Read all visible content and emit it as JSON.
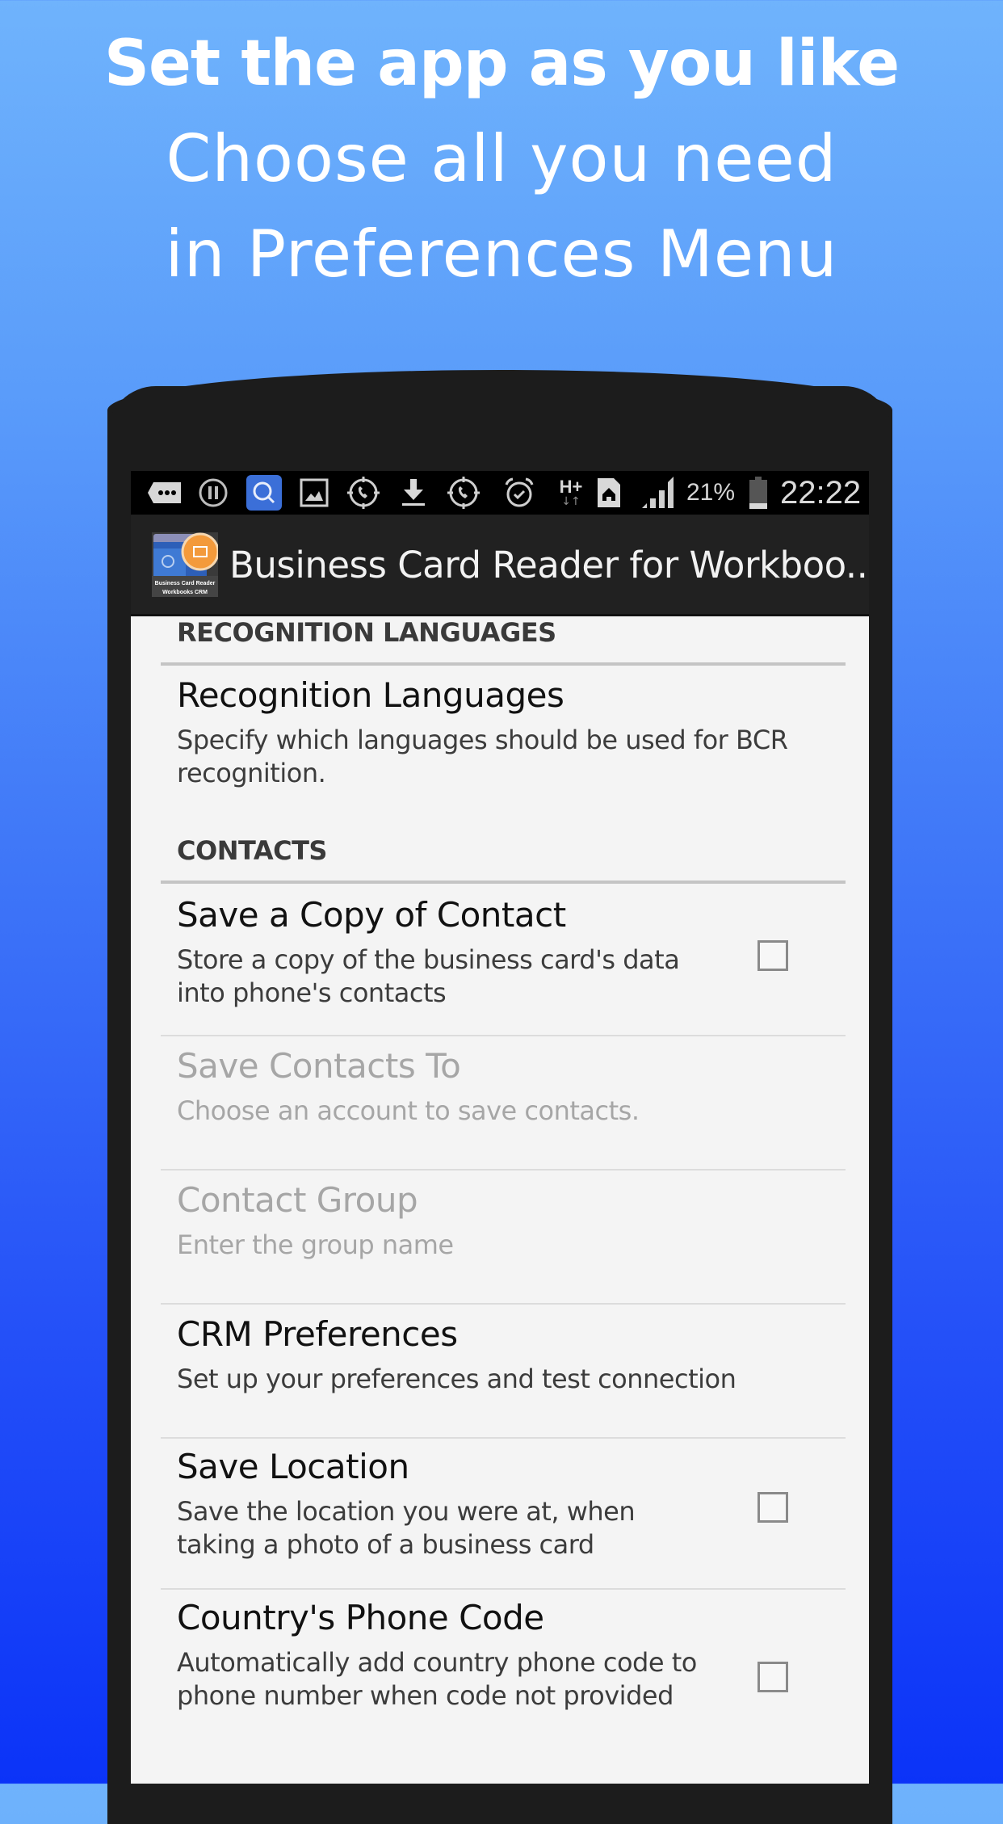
{
  "promo": {
    "headline": "Set the app as you like",
    "subline1": "Choose all you need",
    "subline2": "in Preferences Menu"
  },
  "status_bar": {
    "icons": [
      "messages-icon",
      "pause-icon",
      "search-app-icon",
      "gallery-icon",
      "call-recorder-icon",
      "download-icon",
      "call-recorder-icon",
      "alarm-icon",
      "h-plus-data-icon",
      "home-sim-icon",
      "signal-icon",
      "battery-icon"
    ],
    "network": "H+",
    "battery_percent": "21%",
    "time": "22:22"
  },
  "action_bar": {
    "app_title": "Business Card Reader for Workboo...",
    "icon_caption_1": "Business Card Reader",
    "icon_caption_2": "Workbooks CRM"
  },
  "preferences": {
    "categories": [
      {
        "header": "RECOGNITION LANGUAGES",
        "items": [
          {
            "title": "Recognition Languages",
            "summary": "Specify which languages should be used for BCR recognition.",
            "enabled": true,
            "has_checkbox": false
          }
        ]
      },
      {
        "header": "CONTACTS",
        "items": [
          {
            "title": "Save a Copy of Contact",
            "summary": "Store a copy of the business card's data into phone's contacts",
            "enabled": true,
            "has_checkbox": true,
            "checked": false
          },
          {
            "title": "Save Contacts To",
            "summary": "Choose an account to save contacts.",
            "enabled": false,
            "has_checkbox": false
          },
          {
            "title": "Contact Group",
            "summary": "Enter the group name",
            "enabled": false,
            "has_checkbox": false
          },
          {
            "title": "CRM Preferences",
            "summary": "Set up your preferences and test connection",
            "enabled": true,
            "has_checkbox": false
          },
          {
            "title": "Save Location",
            "summary": "Save the location you were at, when taking a photo of a business card",
            "enabled": true,
            "has_checkbox": true,
            "checked": false
          },
          {
            "title": "Country's Phone Code",
            "summary": "Automatically add country phone code to phone number when code not provided",
            "enabled": true,
            "has_checkbox": true,
            "checked": false
          }
        ]
      }
    ]
  },
  "colors": {
    "bg_top": "#6fb3fc",
    "bg_bottom": "#0b33f8",
    "phone_body": "#1c1c1c",
    "action_bar": "#212121",
    "screen_bg": "#f4f4f4",
    "search_icon_bg": "#3b6fd8",
    "app_icon_orange": "#f39a3b"
  }
}
